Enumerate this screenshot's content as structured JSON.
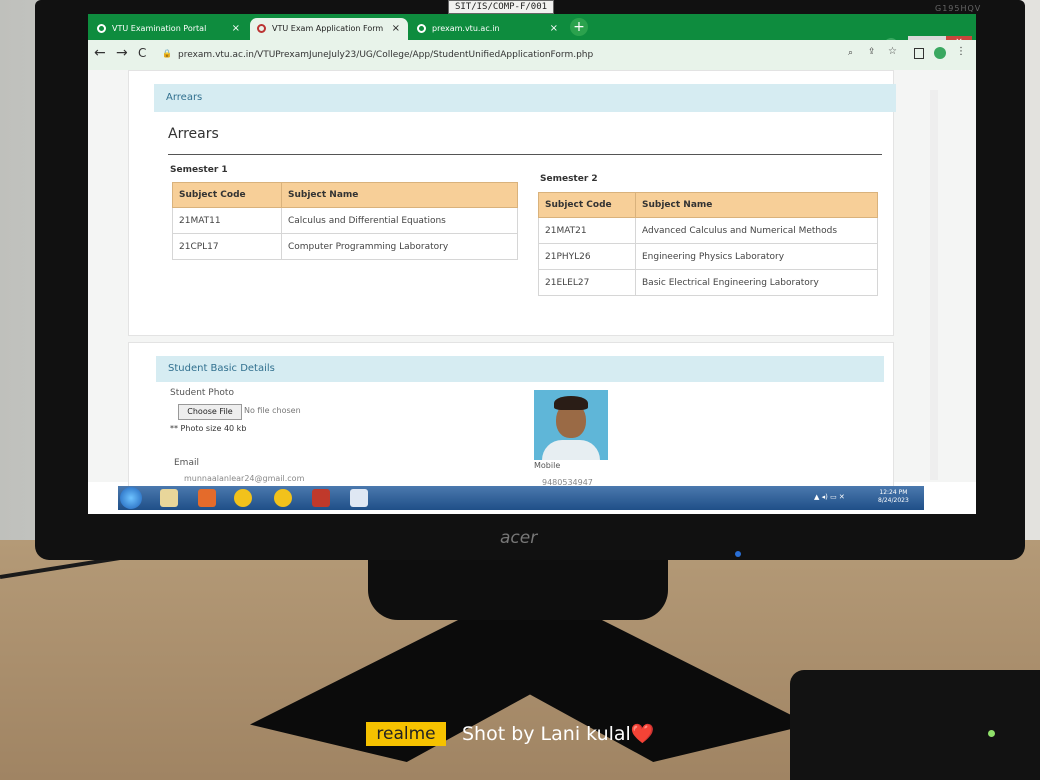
{
  "photo": {
    "label_strip": "SIT/IS/COMP-F/001",
    "monitor_model": "G195HQV",
    "monitor_brand": "acer",
    "watermark_brand": "realme",
    "watermark_text": "Shot by Lani kulal❤️"
  },
  "browser": {
    "tabs": [
      {
        "label": "VTU Examination Portal",
        "close": "×",
        "active": false
      },
      {
        "label": "VTU Exam Application Form",
        "close": "×",
        "active": true
      },
      {
        "label": "prexam.vtu.ac.in",
        "close": "×",
        "active": false
      }
    ],
    "new_tab": "+",
    "url": "prexam.vtu.ac.in/VTUPrexamJuneJuly23/UG/College/App/StudentUnifiedApplicationForm.php",
    "back": "←",
    "forward": "→",
    "reload": "C"
  },
  "arrears": {
    "panel_title": "Arrears",
    "heading": "Arrears",
    "semester1": {
      "title": "Semester 1",
      "columns": [
        "Subject Code",
        "Subject Name"
      ],
      "rows": [
        [
          "21MAT11",
          "Calculus and Differential Equations"
        ],
        [
          "21CPL17",
          "Computer Programming Laboratory"
        ]
      ]
    },
    "semester2": {
      "title": "Semester 2",
      "columns": [
        "Subject Code",
        "Subject Name"
      ],
      "rows": [
        [
          "21MAT21",
          "Advanced Calculus and Numerical Methods"
        ],
        [
          "21PHYL26",
          "Engineering Physics Laboratory"
        ],
        [
          "21ELEL27",
          "Basic Electrical Engineering Laboratory"
        ]
      ]
    }
  },
  "student": {
    "panel_title": "Student Basic Details",
    "photo_label": "Student Photo",
    "choose_file": "Choose File",
    "no_file": "No file chosen",
    "photo_size": "** Photo size 40 kb",
    "email_label": "Email",
    "email_value": "munnaalanlear24@gmail.com",
    "mobile_label": "Mobile",
    "mobile_value": "9480534947"
  },
  "taskbar": {
    "time": "12:24 PM",
    "date": "8/24/2023"
  }
}
